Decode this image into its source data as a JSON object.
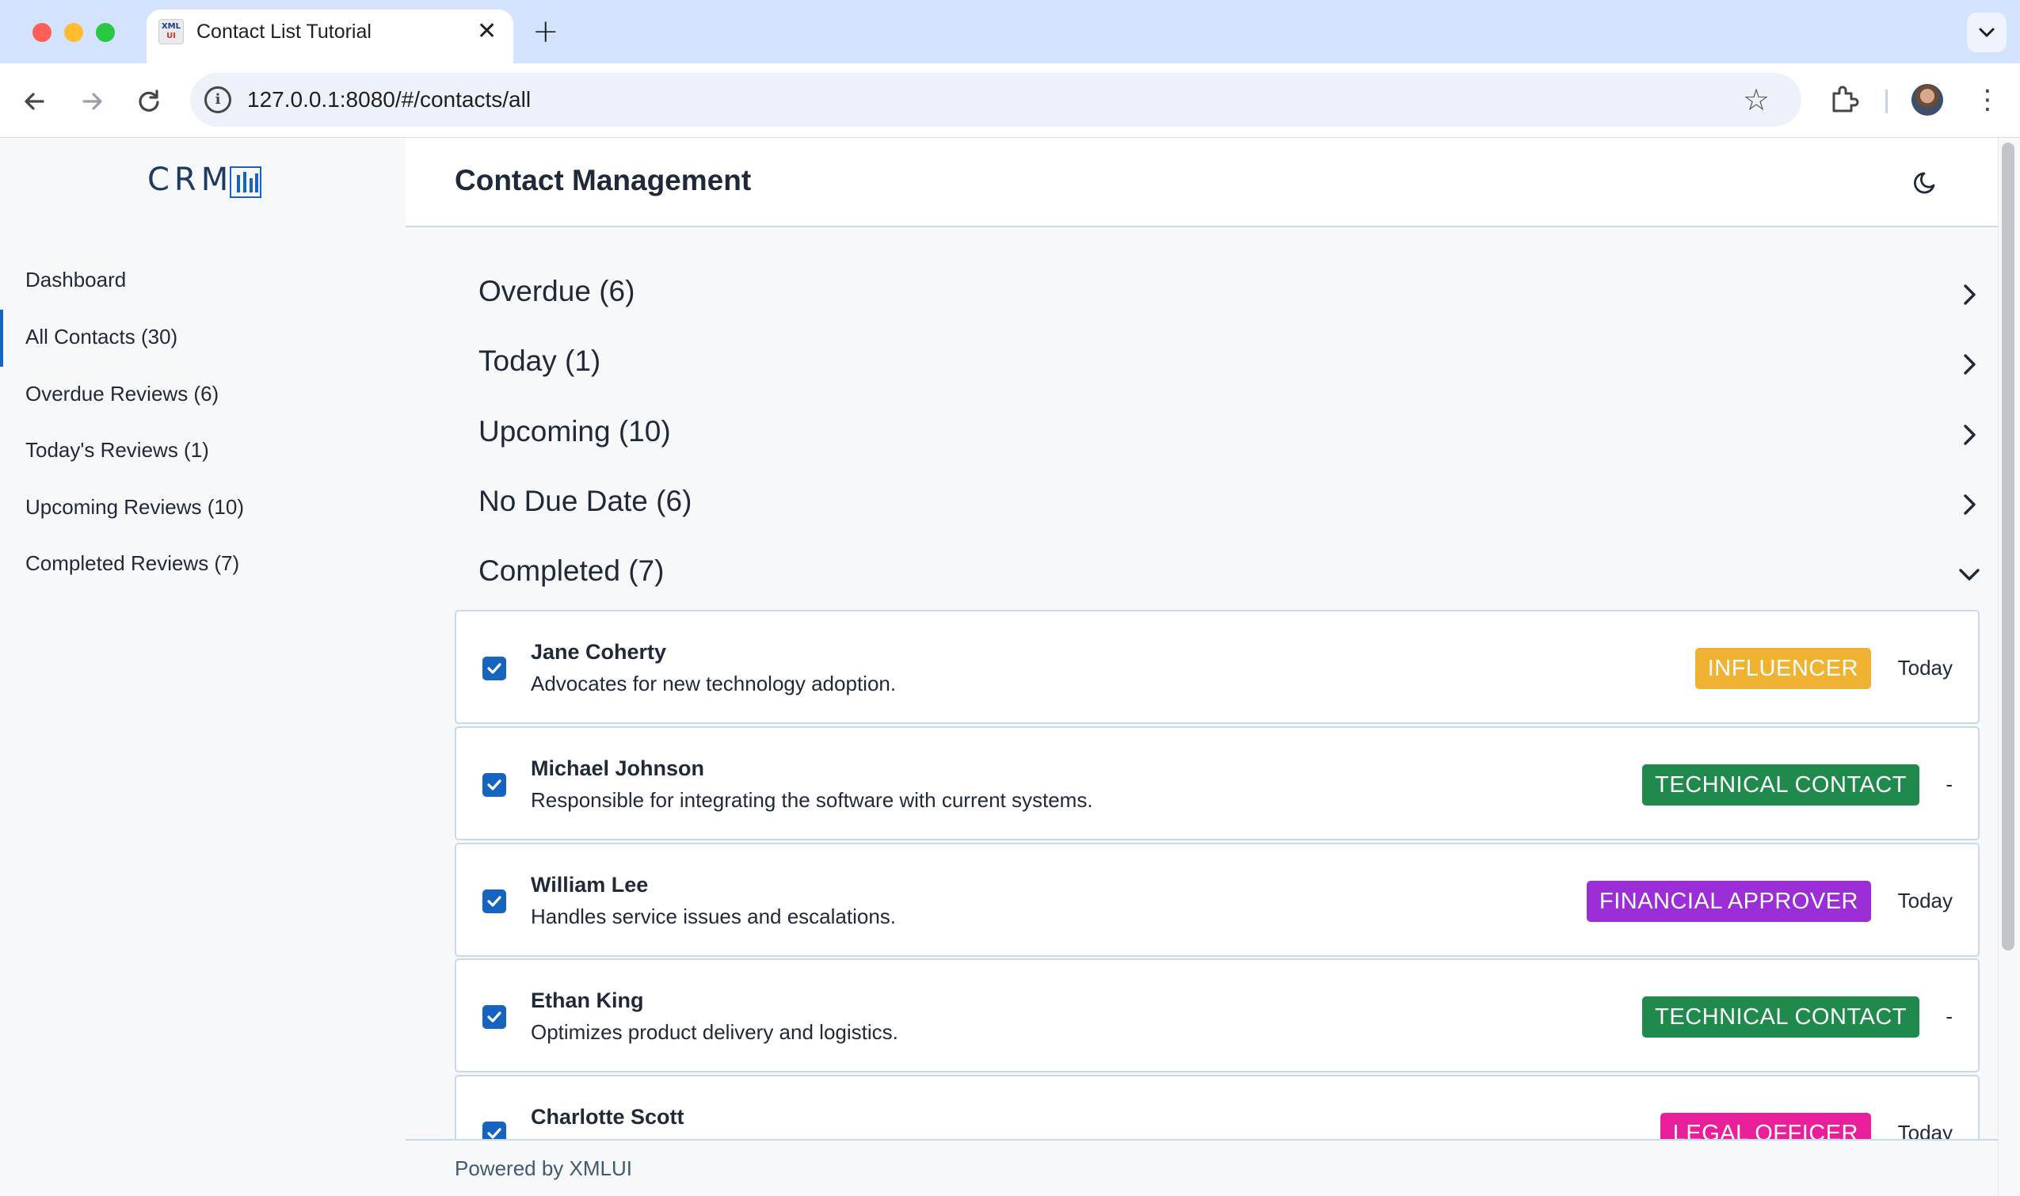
{
  "browser": {
    "tab_title": "Contact List Tutorial",
    "favicon_text_top": "XML",
    "favicon_text_bottom": "UI",
    "url": "127.0.0.1:8080/#/contacts/all"
  },
  "sidebar": {
    "logo": "CRM",
    "items": [
      {
        "label": "Dashboard",
        "active": false
      },
      {
        "label": "All Contacts (30)",
        "active": true
      },
      {
        "label": "Overdue Reviews (6)",
        "active": false
      },
      {
        "label": "Today's Reviews (1)",
        "active": false
      },
      {
        "label": "Upcoming Reviews (10)",
        "active": false
      },
      {
        "label": "Completed Reviews (7)",
        "active": false
      }
    ]
  },
  "header": {
    "title": "Contact Management"
  },
  "sections": [
    {
      "label": "Overdue (6)",
      "expanded": false
    },
    {
      "label": "Today (1)",
      "expanded": false
    },
    {
      "label": "Upcoming (10)",
      "expanded": false
    },
    {
      "label": "No Due Date (6)",
      "expanded": false
    },
    {
      "label": "Completed (7)",
      "expanded": true
    }
  ],
  "contacts": [
    {
      "name": "Jane Coherty",
      "description": "Advocates for new technology adoption.",
      "tag": "Influencer",
      "tag_color": "#f0b232",
      "date": "Today",
      "checked": true
    },
    {
      "name": "Michael Johnson",
      "description": "Responsible for integrating the software with current systems.",
      "tag": "Technical Contact",
      "tag_color": "#1f8a4c",
      "date": "-",
      "checked": true
    },
    {
      "name": "William Lee",
      "description": "Handles service issues and escalations.",
      "tag": "Financial Approver",
      "tag_color": "#9b2ed6",
      "date": "Today",
      "checked": true
    },
    {
      "name": "Ethan King",
      "description": "Optimizes product delivery and logistics.",
      "tag": "Technical Contact",
      "tag_color": "#1f8a4c",
      "date": "-",
      "checked": true
    },
    {
      "name": "Charlotte Scott",
      "description": "",
      "tag": "Legal Officer",
      "tag_color": "#e91e9b",
      "date": "Today",
      "checked": true
    }
  ],
  "footer": {
    "text": "Powered by XMLUI"
  },
  "colors": {
    "accent": "#1565c0",
    "background": "#f6f8fa"
  }
}
